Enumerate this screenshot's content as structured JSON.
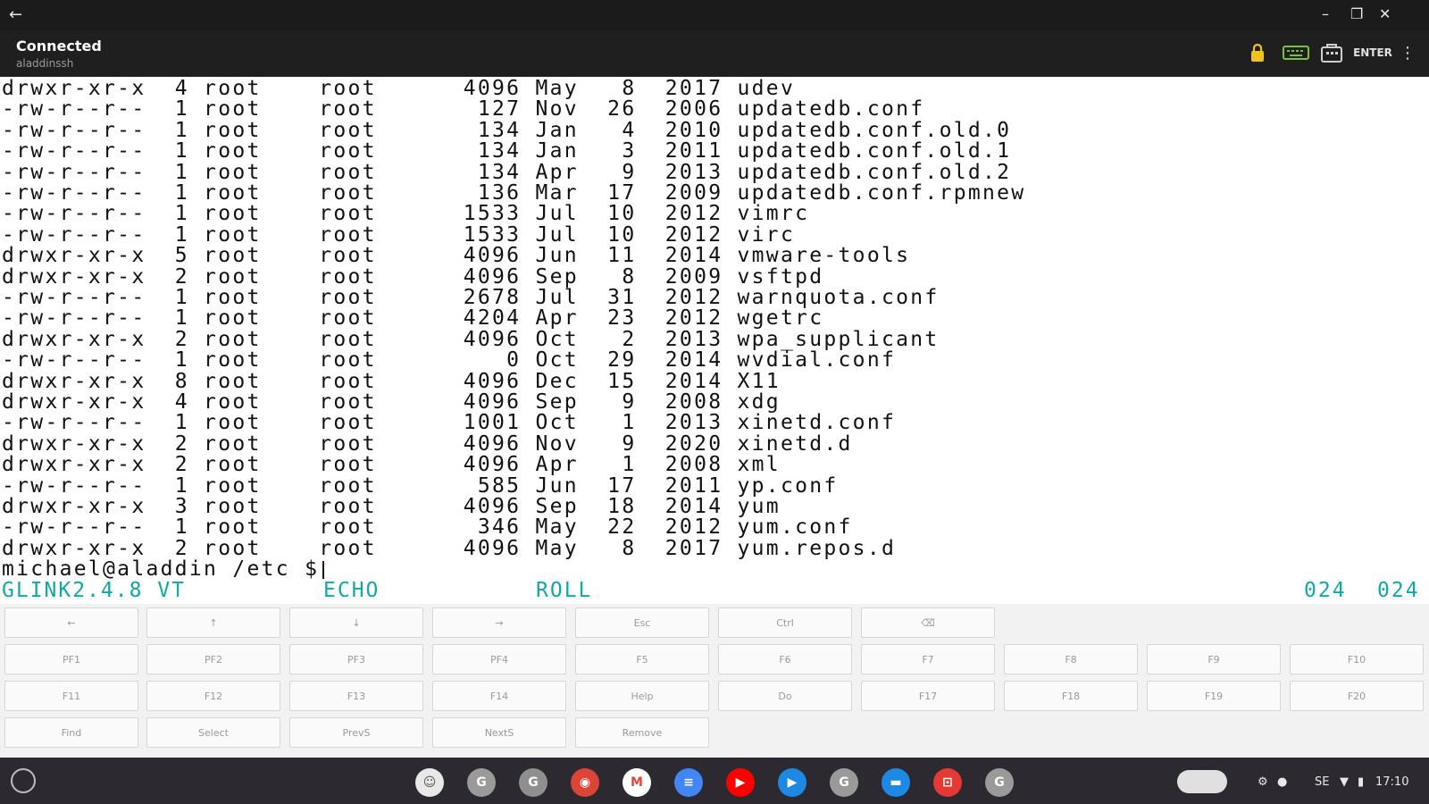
{
  "window": {
    "back_icon": "arrow-left-icon",
    "controls": [
      "minimize-icon",
      "restore-icon",
      "close-icon"
    ]
  },
  "app": {
    "status": "Connected",
    "host": "aladdinssh",
    "enter_label": "ENTER",
    "icons": [
      "lock-icon",
      "keyboard-icon",
      "keypad-icon",
      "enter-key",
      "more-vert-icon"
    ]
  },
  "terminal": {
    "lines": [
      "drwxr-xr-x  4 root    root      4096 May   8  2017 udev",
      "-rw-r--r--  1 root    root       127 Nov  26  2006 updatedb.conf",
      "-rw-r--r--  1 root    root       134 Jan   4  2010 updatedb.conf.old.0",
      "-rw-r--r--  1 root    root       134 Jan   3  2011 updatedb.conf.old.1",
      "-rw-r--r--  1 root    root       134 Apr   9  2013 updatedb.conf.old.2",
      "-rw-r--r--  1 root    root       136 Mar  17  2009 updatedb.conf.rpmnew",
      "-rw-r--r--  1 root    root      1533 Jul  10  2012 vimrc",
      "-rw-r--r--  1 root    root      1533 Jul  10  2012 virc",
      "drwxr-xr-x  5 root    root      4096 Jun  11  2014 vmware-tools",
      "drwxr-xr-x  2 root    root      4096 Sep   8  2009 vsftpd",
      "-rw-r--r--  1 root    root      2678 Jul  31  2012 warnquota.conf",
      "-rw-r--r--  1 root    root      4204 Apr  23  2012 wgetrc",
      "drwxr-xr-x  2 root    root      4096 Oct   2  2013 wpa_supplicant",
      "-rw-r--r--  1 root    root         0 Oct  29  2014 wvdial.conf",
      "drwxr-xr-x  8 root    root      4096 Dec  15  2014 X11",
      "drwxr-xr-x  4 root    root      4096 Sep   9  2008 xdg",
      "-rw-r--r--  1 root    root      1001 Oct   1  2013 xinetd.conf",
      "drwxr-xr-x  2 root    root      4096 Nov   9  2020 xinetd.d",
      "drwxr-xr-x  2 root    root      4096 Apr   1  2008 xml",
      "-rw-r--r--  1 root    root       585 Jun  17  2011 yp.conf",
      "drwxr-xr-x  3 root    root      4096 Sep  18  2014 yum",
      "-rw-r--r--  1 root    root       346 May  22  2012 yum.conf",
      "drwxr-xr-x  2 root    root      4096 May   8  2017 yum.repos.d"
    ],
    "prompt": "michael@aladdin /etc $"
  },
  "status_line": {
    "emulator": "GLINK2.4.8 VT",
    "echo": "ECHO",
    "roll": "ROLL",
    "pos_left": "024",
    "pos_right": "024"
  },
  "keypad": {
    "row1": [
      "←",
      "↑",
      "↓",
      "→",
      "Esc",
      "Ctrl",
      "⌫"
    ],
    "row2": [
      "PF1",
      "PF2",
      "PF3",
      "PF4",
      "F5",
      "F6",
      "F7",
      "F8",
      "F9",
      "F10"
    ],
    "row3": [
      "F11",
      "F12",
      "F13",
      "F14",
      "Help",
      "Do",
      "F17",
      "F18",
      "F19",
      "F20"
    ],
    "row4": [
      "Find",
      "Select",
      "PrevS",
      "NextS",
      "Remove"
    ]
  },
  "shelf": {
    "launcher_icon": "launcher-circle-icon",
    "apps": [
      {
        "name": "chat-icon",
        "color": "#e8e8e8",
        "glyph": "☺"
      },
      {
        "name": "glink-app-icon-1",
        "color": "#9a9a9a",
        "glyph": "G"
      },
      {
        "name": "glink-app-icon-2",
        "color": "#8f8f8f",
        "glyph": "G"
      },
      {
        "name": "chrome-icon",
        "color": "#db4437",
        "glyph": "◉"
      },
      {
        "name": "gmail-icon",
        "color": "#ffffff",
        "glyph": "M"
      },
      {
        "name": "docs-icon",
        "color": "#4285f4",
        "glyph": "≡"
      },
      {
        "name": "youtube-icon",
        "color": "#ff0000",
        "glyph": "▶"
      },
      {
        "name": "play-store-icon",
        "color": "#1e88e5",
        "glyph": "▶"
      },
      {
        "name": "glink-app-icon-3",
        "color": "#9a9a9a",
        "glyph": "G"
      },
      {
        "name": "files-icon",
        "color": "#1e88e5",
        "glyph": "▬"
      },
      {
        "name": "screenshot-icon",
        "color": "#e53935",
        "glyph": "⊡"
      },
      {
        "name": "glink-app-icon-4",
        "color": "#9a9a9a",
        "glyph": "G"
      }
    ],
    "tray": {
      "locale": "SE",
      "time": "17:10",
      "icons": [
        "user-avatar-icon",
        "settings-icon",
        "notification-icon",
        "wifi-icon",
        "battery-icon"
      ]
    }
  }
}
